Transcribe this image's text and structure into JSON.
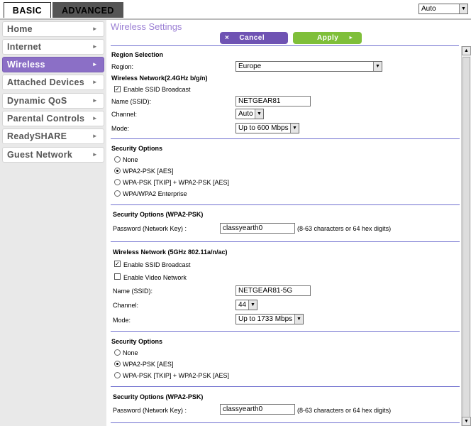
{
  "tabs": {
    "basic": "BASIC",
    "advanced": "ADVANCED"
  },
  "language": {
    "selected": "Auto"
  },
  "sidebar": {
    "items": [
      {
        "label": "Home"
      },
      {
        "label": "Internet"
      },
      {
        "label": "Wireless"
      },
      {
        "label": "Attached Devices"
      },
      {
        "label": "Dynamic QoS"
      },
      {
        "label": "Parental Controls"
      },
      {
        "label": "ReadySHARE"
      },
      {
        "label": "Guest Network"
      }
    ]
  },
  "page": {
    "title": "Wireless Settings"
  },
  "buttons": {
    "cancel": "Cancel",
    "apply": "Apply",
    "cancel_icon": "×",
    "apply_icon": "►"
  },
  "region": {
    "heading": "Region Selection",
    "label": "Region:",
    "value": "Europe"
  },
  "wifi24": {
    "heading": "Wireless Network(2.4GHz b/g/n)",
    "ssid_broadcast_label": "Enable SSID Broadcast",
    "ssid_label": "Name (SSID):",
    "ssid_value": "NETGEAR81",
    "channel_label": "Channel:",
    "channel_value": "Auto",
    "mode_label": "Mode:",
    "mode_value": "Up to 600 Mbps"
  },
  "security24": {
    "heading": "Security Options",
    "opt_none": "None",
    "opt_wpa2": "WPA2-PSK [AES]",
    "opt_mixed": "WPA-PSK [TKIP] + WPA2-PSK [AES]",
    "opt_enterprise": "WPA/WPA2 Enterprise",
    "psk_heading": "Security Options (WPA2-PSK)",
    "password_label": "Password (Network Key) :",
    "password_value": "classyearth0",
    "password_hint": "(8-63 characters or 64 hex digits)"
  },
  "wifi5": {
    "heading": "Wireless Network (5GHz 802.11a/n/ac)",
    "ssid_broadcast_label": "Enable SSID Broadcast",
    "video_label": "Enable Video Network",
    "ssid_label": "Name (SSID):",
    "ssid_value": "NETGEAR81-5G",
    "channel_label": "Channel:",
    "channel_value": "44",
    "mode_label": "Mode:",
    "mode_value": "Up to 1733 Mbps"
  },
  "security5": {
    "heading": "Security Options",
    "opt_none": "None",
    "opt_wpa2": "WPA2-PSK [AES]",
    "opt_mixed": "WPA-PSK [TKIP] + WPA2-PSK [AES]",
    "psk_heading": "Security Options (WPA2-PSK)",
    "password_label": "Password (Network Key) :",
    "password_value": "classyearth0",
    "password_hint": "(8-63 characters or 64 hex digits)"
  },
  "colors": {
    "accent": "#8b6fc6",
    "cancel": "#6f53b3",
    "apply": "#7fbf3a",
    "title": "#9b7fd4"
  }
}
